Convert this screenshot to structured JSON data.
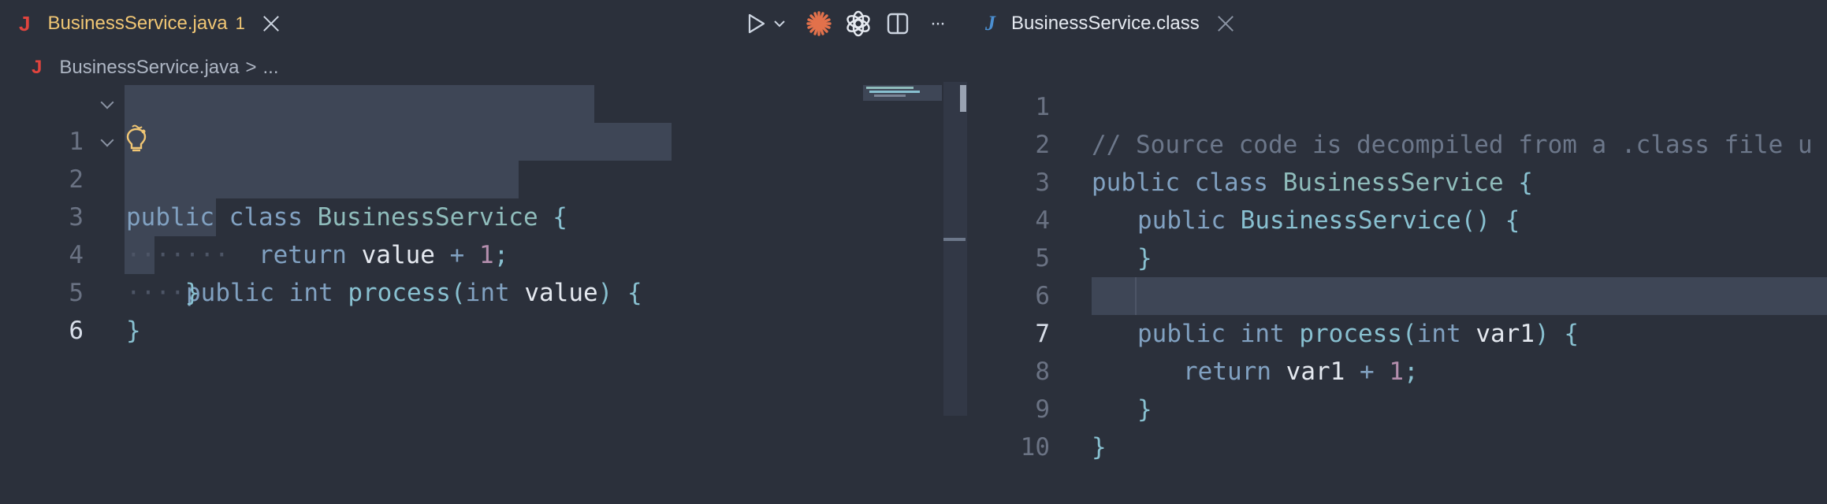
{
  "left": {
    "tab": {
      "icon": "java-icon",
      "icon_glyph": "J",
      "title": "BusinessService.java",
      "badge": "1"
    },
    "breadcrumb": {
      "file": "BusinessService.java",
      "separator": ">",
      "rest": "..."
    },
    "lines": [
      {
        "num": "1"
      },
      {
        "num": "2"
      },
      {
        "num": "3"
      },
      {
        "num": "4"
      },
      {
        "num": "5"
      },
      {
        "num": "6"
      }
    ],
    "code": {
      "l1": [
        "public",
        "class",
        "BusinessService",
        "{"
      ],
      "l2": [
        "public",
        "int",
        "process",
        "(",
        "int",
        "value",
        ")",
        "{"
      ],
      "l3": [
        "return",
        "value",
        "+",
        "1",
        ";"
      ],
      "l4": [
        "}"
      ],
      "l5": [
        "}"
      ]
    },
    "indent_dots": {
      "l3": "·······",
      "l4": "····"
    }
  },
  "toolbar": {
    "run_icon": "run-icon",
    "run_dropdown_icon": "chevron-down-icon",
    "claude_icon": "claude-icon",
    "openai_icon": "openai-icon",
    "split_icon": "split-editor-icon",
    "more_label": "···"
  },
  "right": {
    "tab": {
      "icon": "class-icon",
      "icon_glyph": "J",
      "title": "BusinessService.class"
    },
    "active_line": "7",
    "lines": [
      {
        "num": "1"
      },
      {
        "num": "2"
      },
      {
        "num": "3"
      },
      {
        "num": "4"
      },
      {
        "num": "5"
      },
      {
        "num": "6"
      },
      {
        "num": "7"
      },
      {
        "num": "8"
      },
      {
        "num": "9"
      },
      {
        "num": "10"
      }
    ],
    "code": {
      "l1": "// Source code is decompiled from a .class file u",
      "l2": [
        "public",
        "class",
        "BusinessService",
        "{"
      ],
      "l3": [
        "public",
        "BusinessService",
        "()",
        "{"
      ],
      "l4": [
        "}"
      ],
      "l6": [
        "public",
        "int",
        "process",
        "(",
        "int",
        "var1",
        ")",
        "{"
      ],
      "l7": [
        "return",
        "var1",
        "+",
        "1",
        ";"
      ],
      "l8": [
        "}"
      ],
      "l9": [
        "}"
      ]
    }
  },
  "colors": {
    "background": "#2b303b",
    "selection": "#3e4656",
    "keyword": "#81a1c1",
    "type": "#8fbcbb",
    "function": "#88c0d0",
    "number": "#b48ead",
    "comment": "#6c778a",
    "modified_tab": "#f0c674",
    "java_icon": "#e0443e",
    "class_icon": "#4b8fd1",
    "claude_icon": "#e2714b"
  }
}
